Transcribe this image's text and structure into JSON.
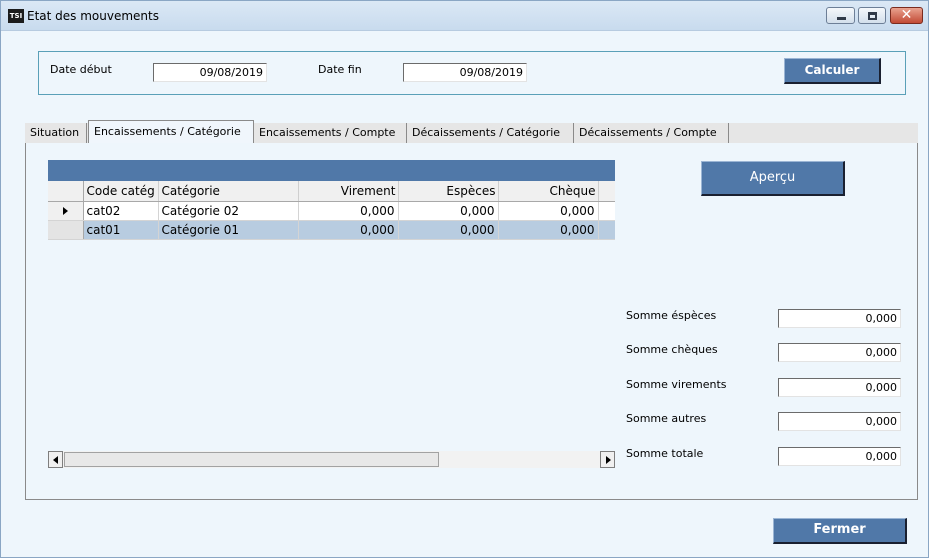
{
  "window": {
    "app_icon_text": "TSI",
    "title": "Etat des mouvements",
    "controls": {
      "minimize": "minimize",
      "maximize": "maximize",
      "close": "✕"
    }
  },
  "dates": {
    "start_label": "Date début",
    "start_value": "09/08/2019",
    "end_label": "Date fin",
    "end_value": "09/08/2019",
    "calculate_label": "Calculer"
  },
  "tabs": [
    {
      "label": "Situation"
    },
    {
      "label": "Encaissements / Catégorie"
    },
    {
      "label": "Encaissements / Compte"
    },
    {
      "label": "Décaissements / Catégorie"
    },
    {
      "label": "Décaissements / Compte"
    }
  ],
  "active_tab": "Encaissements / Catégorie",
  "grid": {
    "columns": [
      "Code catég",
      "Catégorie",
      "Virement",
      "Espèces",
      "Chèque"
    ],
    "rows": [
      {
        "code": "cat02",
        "categorie": "Catégorie 02",
        "virement": "0,000",
        "especes": "0,000",
        "cheque": "0,000",
        "current": true
      },
      {
        "code": "cat01",
        "categorie": "Catégorie 01",
        "virement": "0,000",
        "especes": "0,000",
        "cheque": "0,000",
        "selected": true
      }
    ]
  },
  "preview_label": "Aperçu",
  "sums": [
    {
      "label": "Somme éspèces",
      "value": "0,000"
    },
    {
      "label": "Somme chèques",
      "value": "0,000"
    },
    {
      "label": "Somme virements",
      "value": "0,000"
    },
    {
      "label": "Somme autres",
      "value": "0,000"
    },
    {
      "label": "Somme totale",
      "value": "0,000"
    }
  ],
  "close_label": "Fermer",
  "colors": {
    "button": "#5078a8",
    "background": "#eef6fc",
    "selection": "#b8cce0"
  }
}
